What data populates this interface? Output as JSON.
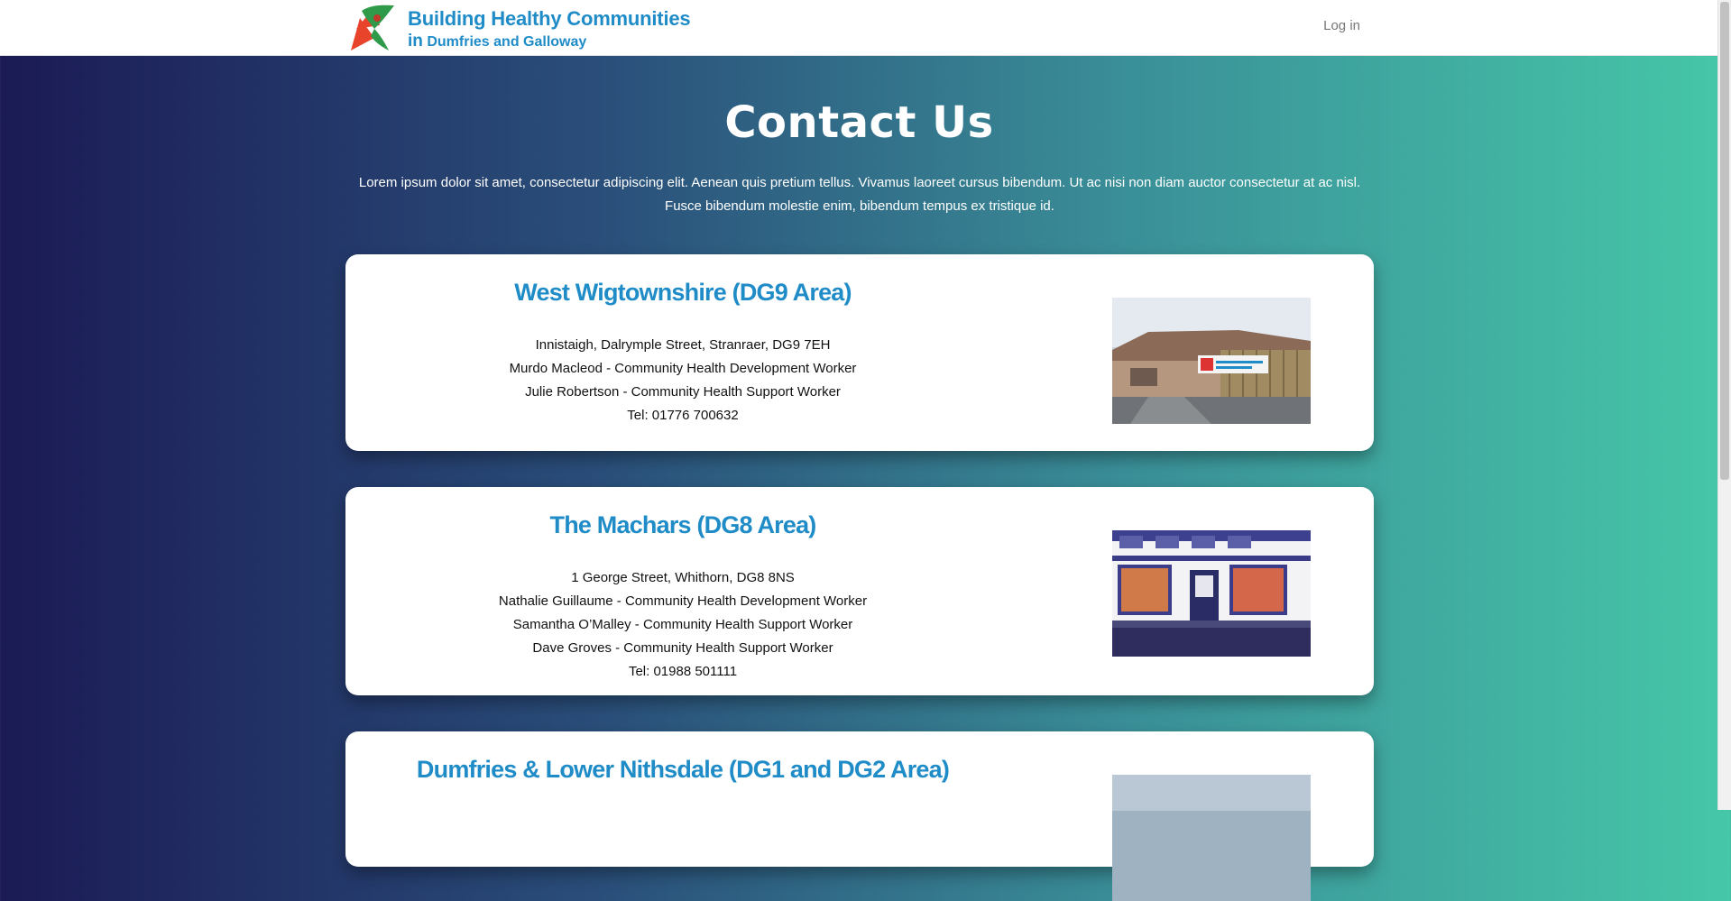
{
  "header": {
    "logo_title": "Building Healthy Communities",
    "logo_sub_in": "in",
    "logo_sub_place": "Dumfries and Galloway",
    "login_label": "Log in"
  },
  "hero": {
    "title": "Contact Us",
    "intro_line1": "Lorem ipsum dolor sit amet, consectetur adipiscing elit. Aenean quis pretium tellus. Vivamus laoreet cursus bibendum. Ut ac nisi non diam auctor consectetur at ac nisl.",
    "intro_line2": "Fusce bibendum molestie enim, bibendum tempus ex tristique id."
  },
  "cards": [
    {
      "title": "West Wigtownshire (DG9 Area)",
      "lines": [
        "Innistaigh, Dalrymple Street, Stranraer, DG9 7EH",
        "Murdo Macleod - Community Health Development Worker",
        "Julie Robertson - Community Health Support Worker",
        "Tel: 01776 700632"
      ]
    },
    {
      "title": "The Machars (DG8 Area)",
      "lines": [
        "1 George Street, Whithorn, DG8 8NS",
        "Nathalie Guillaume - Community Health Development Worker",
        "Samantha O’Malley - Community Health Support Worker",
        "Dave Groves - Community Health Support Worker",
        "Tel: 01988 501111"
      ]
    },
    {
      "title": "Dumfries & Lower Nithsdale (DG1 and DG2 Area)",
      "lines": []
    }
  ],
  "colors": {
    "accent": "#1f8cc8",
    "gradient_left": "#1b1a55",
    "gradient_right": "#46c7a8"
  }
}
